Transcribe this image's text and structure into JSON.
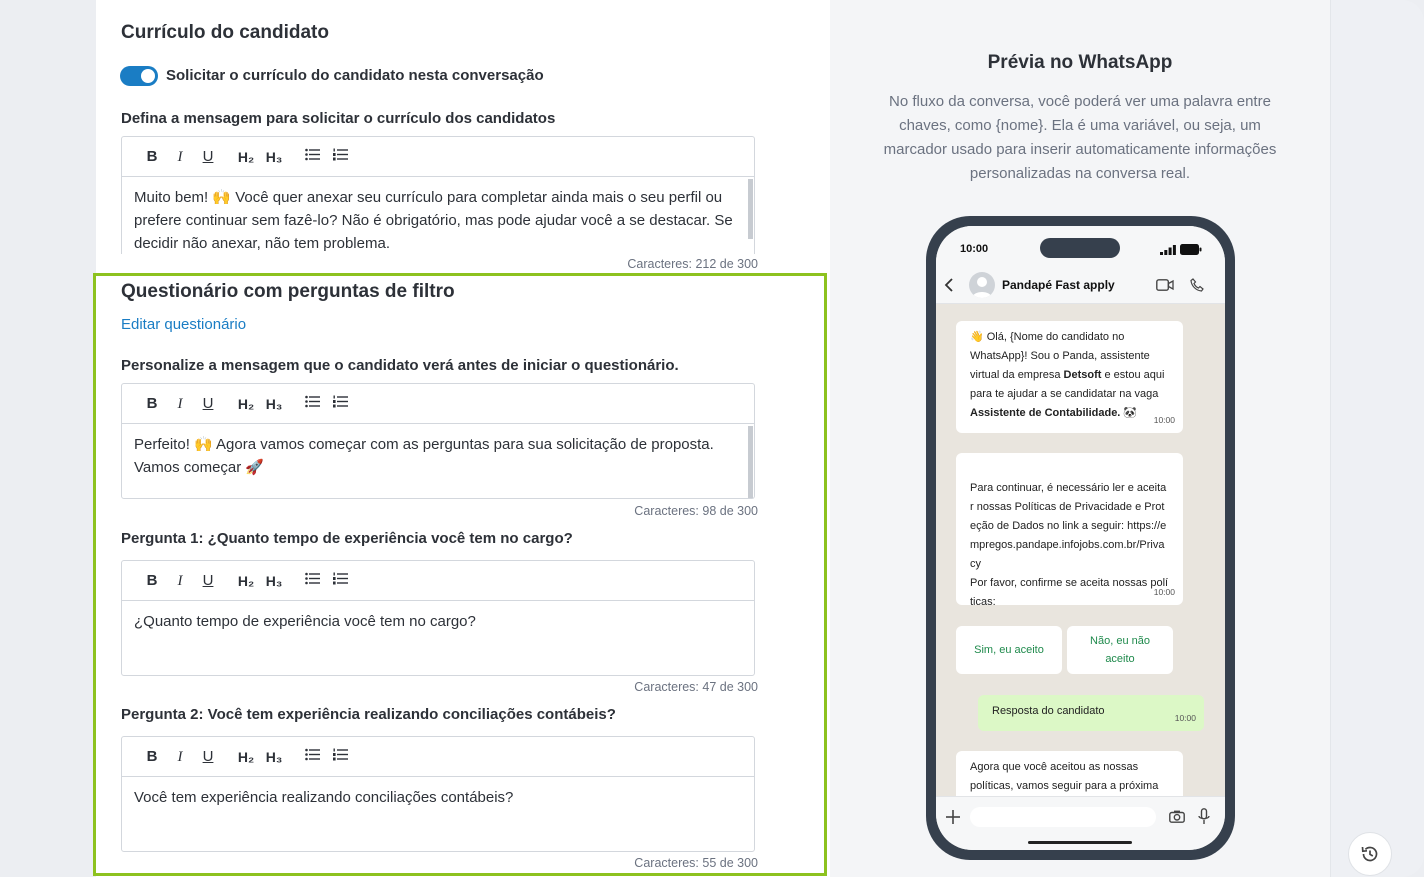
{
  "curriculum": {
    "title": "Currículo do candidato",
    "toggle_label": "Solicitar o currículo do candidato nesta conversação",
    "message_label": "Defina a mensagem para solicitar o currículo dos candidatos",
    "editor_text": "Muito bem! 🙌 Você quer anexar seu currículo para completar ainda mais o seu perfil ou prefere continuar sem fazê-lo? Não é obrigatório, mas pode ajudar você a se destacar. Se decidir não anexar, não tem problema.",
    "counter": "Caracteres: 212 de 300"
  },
  "toolbar": {
    "bold": "B",
    "italic": "I",
    "underline": "U",
    "h2": "H₂",
    "h3": "H₃"
  },
  "questionnaire": {
    "title": "Questionário com perguntas de filtro",
    "edit_link": "Editar questionário",
    "intro_label": "Personalize a mensagem que o candidato verá antes de iniciar o questionário.",
    "intro_text": "Perfeito! 🙌 Agora vamos começar com as perguntas para sua solicitação de proposta. Vamos começar 🚀",
    "intro_counter": "Caracteres: 98 de 300",
    "questions": [
      {
        "label": "Pergunta 1: ¿Quanto tempo de experiência você tem no cargo?",
        "text": "¿Quanto tempo de experiência você tem no cargo?",
        "counter": "Caracteres: 47 de 300"
      },
      {
        "label": "Pergunta 2: Você tem experiência realizando conciliações contábeis?",
        "text": "Você tem experiência realizando conciliações contábeis?",
        "counter": "Caracteres: 55 de 300"
      }
    ]
  },
  "preview": {
    "title": "Prévia no WhatsApp",
    "description": "No fluxo da conversa, você poderá ver uma palavra entre chaves, como {nome}. Ela é uma variável, ou seja, um marcador usado para inserir automaticamente informações personalizadas na conversa real.",
    "phone": {
      "time": "10:00",
      "contact": "Pandapé Fast apply",
      "messages": [
        {
          "pre": "👋 Olá, {Nome do candidato no WhatsApp}! Sou o Panda, assistente virtual da empresa ",
          "bold1": "Detsoft",
          "mid": " e estou aqui para te ajudar a se candidatar na vaga ",
          "bold2": "Assistente de Contabilidade.",
          "post": " 🐼",
          "time": "10:00"
        },
        {
          "text": "Para continuar, é necessário ler e aceitar nossas Políticas de Privacidade e Proteção de Dados no link a seguir: https://empregos.pandape.infojobs.com.br/Privacy\nPor favor, confirme se aceita nossas políticas:",
          "time": "10:00"
        },
        {
          "text": "Resposta do candidato",
          "time": "10:00"
        },
        {
          "text": "Agora que você aceitou as nossas políticas, vamos seguir para a próxima"
        }
      ],
      "quick_replies": [
        "Sim, eu aceito",
        "Não, eu não aceito"
      ]
    }
  },
  "colors": {
    "accent": "#1a7dc4",
    "highlight": "#8dc21f",
    "phone_frame": "#36404d"
  }
}
